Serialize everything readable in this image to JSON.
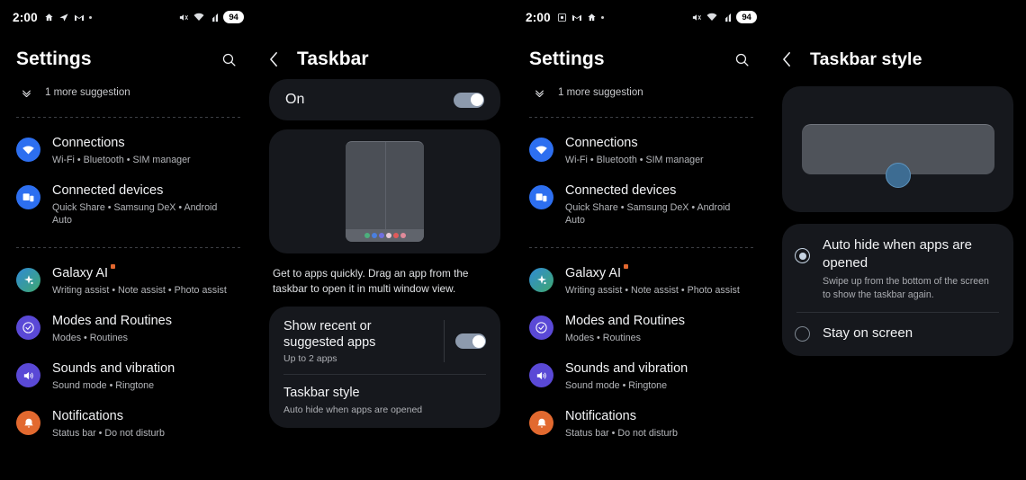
{
  "status_bar": {
    "time": "2:00",
    "battery": "94",
    "left_icons_panel1": [
      "home-icon",
      "telegram-send-icon",
      "gmail-icon",
      "dot-icon"
    ],
    "left_icons_panel3": [
      "screen-record-icon",
      "gmail-icon",
      "home-icon",
      "dot-icon"
    ],
    "right_icons": [
      "mute-icon",
      "wifi-icon",
      "signal-icon"
    ]
  },
  "settings_page": {
    "title": "Settings",
    "search_label": "Search",
    "suggestion": "1 more suggestion",
    "items": [
      {
        "title": "Connections",
        "subtitle": "Wi-Fi • Bluetooth • SIM manager",
        "icon": "wifi-icon",
        "icon_color": "#2d6ff0",
        "badge": false
      },
      {
        "title": "Connected devices",
        "subtitle": "Quick Share • Samsung DeX • Android Auto",
        "icon": "devices-icon",
        "icon_color": "#2d6ff0",
        "badge": false
      },
      {
        "title": "Galaxy AI",
        "subtitle": "Writing assist • Note assist • Photo assist",
        "icon": "sparkle-icon",
        "icon_color": "#2f8ad6",
        "badge": true
      },
      {
        "title": "Modes and Routines",
        "subtitle": "Modes • Routines",
        "icon": "moon-clock-icon",
        "icon_color": "#5a49d6",
        "badge": false
      },
      {
        "title": "Sounds and vibration",
        "subtitle": "Sound mode • Ringtone",
        "icon": "speaker-icon",
        "icon_color": "#5a49d6",
        "badge": false
      },
      {
        "title": "Notifications",
        "subtitle": "Status bar • Do not disturb",
        "icon": "bell-icon",
        "icon_color": "#e2692f",
        "badge": false
      }
    ]
  },
  "taskbar_page": {
    "title": "Taskbar",
    "back_label": "Back",
    "master_toggle_label": "On",
    "master_toggle_state": "on",
    "description": "Get to apps quickly. Drag an app from the taskbar to open it in multi window view.",
    "recent_apps": {
      "title": "Show recent or suggested apps",
      "subtitle": "Up to 2 apps",
      "toggle_state": "on"
    },
    "taskbar_style_row": {
      "title": "Taskbar style",
      "subtitle": "Auto hide when apps are opened"
    },
    "dock_dot_colors": [
      "#4caf7d",
      "#4a7fe0",
      "#6f6fe0",
      "#e8c9d6",
      "#e05a5a",
      "#e08a9a"
    ]
  },
  "taskbar_style_page": {
    "title": "Taskbar style",
    "back_label": "Back",
    "options": [
      {
        "title": "Auto hide when apps are opened",
        "subtitle": "Swipe up from the bottom of the screen to show the taskbar again.",
        "selected": true
      },
      {
        "title": "Stay on screen",
        "subtitle": "",
        "selected": false
      }
    ]
  },
  "colors": {
    "background": "#000000",
    "card": "#16181d",
    "accent": "#c6d4e3",
    "badge": "#e2672f"
  }
}
